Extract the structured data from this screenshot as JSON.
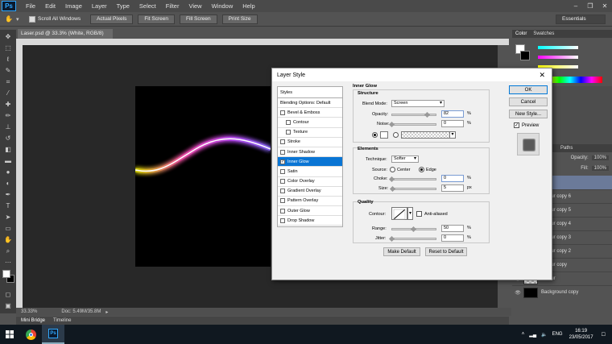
{
  "app": {
    "logo": "Ps",
    "menu": [
      "File",
      "Edit",
      "Image",
      "Layer",
      "Type",
      "Select",
      "Filter",
      "View",
      "Window",
      "Help"
    ]
  },
  "options_bar": {
    "scroll_all": "Scroll All Windows",
    "actual_pixels": "Actual Pixels",
    "fit_screen": "Fit Screen",
    "fill_screen": "Fill Screen",
    "print_size": "Print Size",
    "workspace": "Essentials"
  },
  "document": {
    "tab_title": "Laser.psd @ 33.3% (White, RGB/8) *",
    "zoom": "33.33%",
    "doc_size": "Doc: 5.49M/35.8M"
  },
  "bottom_tabs": {
    "mini_bridge": "Mini Bridge",
    "timeline": "Timeline"
  },
  "panels": {
    "color_tab": "Color",
    "swatches_tab": "Swatches",
    "paths_tab": "Paths",
    "opacity_label": "Opacity:",
    "opacity_value": "100%",
    "fill_label": "Fill:",
    "fill_value": "100%",
    "layers": [
      "Colour copy 6",
      "Colour copy 5",
      "Colour copy 4",
      "Colour copy 3",
      "Colour copy 2",
      "Colour copy",
      "Colour",
      "Background copy"
    ]
  },
  "dialog": {
    "title": "Layer Style",
    "styles_header": "Styles",
    "style_items": [
      {
        "label": "Blending Options: Default",
        "check": false,
        "sub": false,
        "sel": false
      },
      {
        "label": "Bevel & Emboss",
        "check": true,
        "sub": false,
        "sel": false
      },
      {
        "label": "Contour",
        "check": true,
        "sub": true,
        "sel": false
      },
      {
        "label": "Texture",
        "check": true,
        "sub": true,
        "sel": false
      },
      {
        "label": "Stroke",
        "check": true,
        "sub": false,
        "sel": false
      },
      {
        "label": "Inner Shadow",
        "check": true,
        "sub": false,
        "sel": false
      },
      {
        "label": "Inner Glow",
        "check": true,
        "sub": false,
        "sel": true
      },
      {
        "label": "Satin",
        "check": true,
        "sub": false,
        "sel": false
      },
      {
        "label": "Color Overlay",
        "check": true,
        "sub": false,
        "sel": false
      },
      {
        "label": "Gradient Overlay",
        "check": true,
        "sub": false,
        "sel": false
      },
      {
        "label": "Pattern Overlay",
        "check": true,
        "sub": false,
        "sel": false
      },
      {
        "label": "Outer Glow",
        "check": true,
        "sub": false,
        "sel": false
      },
      {
        "label": "Drop Shadow",
        "check": true,
        "sub": false,
        "sel": false
      }
    ],
    "section_title": "Inner Glow",
    "structure": {
      "title": "Structure",
      "blend_mode_label": "Blend Mode:",
      "blend_mode": "Screen",
      "opacity_label": "Opacity:",
      "opacity": "82",
      "noise_label": "Noise:",
      "noise": "0",
      "unit": "%"
    },
    "elements": {
      "title": "Elements",
      "technique_label": "Technique:",
      "technique": "Softer",
      "source_label": "Source:",
      "source_center": "Center",
      "source_edge": "Edge",
      "choke_label": "Choke:",
      "choke": "0",
      "size_label": "Size:",
      "size": "5",
      "size_unit": "px"
    },
    "quality": {
      "title": "Quality",
      "contour_label": "Contour:",
      "anti_aliased": "Anti-aliased",
      "range_label": "Range:",
      "range": "50",
      "jitter_label": "Jitter:",
      "jitter": "0"
    },
    "make_default": "Make Default",
    "reset_default": "Reset to Default",
    "ok": "OK",
    "cancel": "Cancel",
    "new_style": "New Style...",
    "preview": "Preview"
  },
  "taskbar": {
    "lang": "ENG",
    "time": "16:19",
    "date": "23/05/2017"
  }
}
